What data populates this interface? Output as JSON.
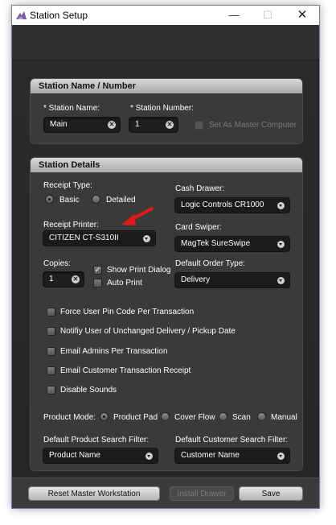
{
  "window": {
    "title": "Station Setup",
    "buttons": {
      "minimize": "—",
      "maximize": "☐",
      "close": "✕"
    }
  },
  "station_name_panel": {
    "header": "Station Name / Number",
    "station_name_label": "* Station Name:",
    "station_name_value": "Main",
    "station_number_label": "* Station Number:",
    "station_number_value": "1",
    "master_computer_label": "Set As Master Computer",
    "master_computer_checked": false
  },
  "station_details_panel": {
    "header": "Station Details",
    "receipt_type_label": "Receipt Type:",
    "receipt_type_options": [
      "Basic",
      "Detailed"
    ],
    "receipt_type_selected": "Basic",
    "cash_drawer_label": "Cash Drawer:",
    "cash_drawer_value": "Logic Controls CR1000",
    "receipt_printer_label": "Receipt Printer:",
    "receipt_printer_value": "CITIZEN CT-S310II",
    "card_swiper_label": "Card Swiper:",
    "card_swiper_value": "MagTek SureSwipe",
    "copies_label": "Copies:",
    "copies_value": "1",
    "show_print_dialog_label": "Show Print Dialog",
    "show_print_dialog_checked": true,
    "auto_print_label": "Auto Print",
    "auto_print_checked": false,
    "default_order_type_label": "Default Order Type:",
    "default_order_type_value": "Delivery",
    "options": [
      "Force User Pin Code Per Transaction",
      "Notifiy User of Unchanged Delivery / Pickup Date",
      "Email Admins Per Transaction",
      "Email Customer Transaction Receipt",
      "Disable Sounds"
    ],
    "product_mode_label": "Product Mode:",
    "product_mode_options": [
      "Product Pad",
      "Cover Flow",
      "Scan",
      "Manual"
    ],
    "product_mode_selected": "Product Pad",
    "product_search_filter_label": "Default Product Search Filter:",
    "product_search_filter_value": "Product Name",
    "customer_search_filter_label": "Default Customer Search Filter:",
    "customer_search_filter_value": "Customer Name"
  },
  "footer": {
    "reset_label": "Reset Master Workstation",
    "install_drawer_label": "Install Drawer",
    "save_label": "Save"
  },
  "colors": {
    "annotation_arrow": "#e0191b",
    "window_border": "#8a6fb0"
  }
}
